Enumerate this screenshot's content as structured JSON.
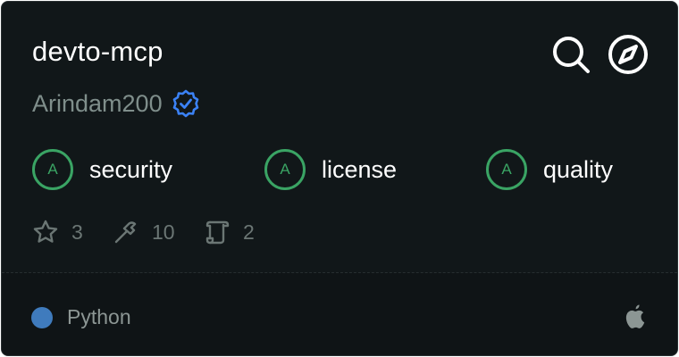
{
  "server": {
    "name": "devto-mcp",
    "author": "Arindam200"
  },
  "icons": {
    "search": "search-icon",
    "explore": "compass-icon",
    "verified": "verified-badge-icon",
    "stars": "star-icon",
    "tools": "hammer-icon",
    "resources": "scroll-icon",
    "platform": "apple-icon"
  },
  "scores": [
    {
      "grade": "A",
      "label": "security"
    },
    {
      "grade": "A",
      "label": "license"
    },
    {
      "grade": "A",
      "label": "quality"
    }
  ],
  "stats": {
    "stars": "3",
    "tools": "10",
    "resources": "2"
  },
  "footer": {
    "language": "Python",
    "language_color": "#3f7bbd"
  },
  "colors": {
    "background": "#111719",
    "grade_green": "#3aa464",
    "verified_blue": "#3b82f6"
  }
}
